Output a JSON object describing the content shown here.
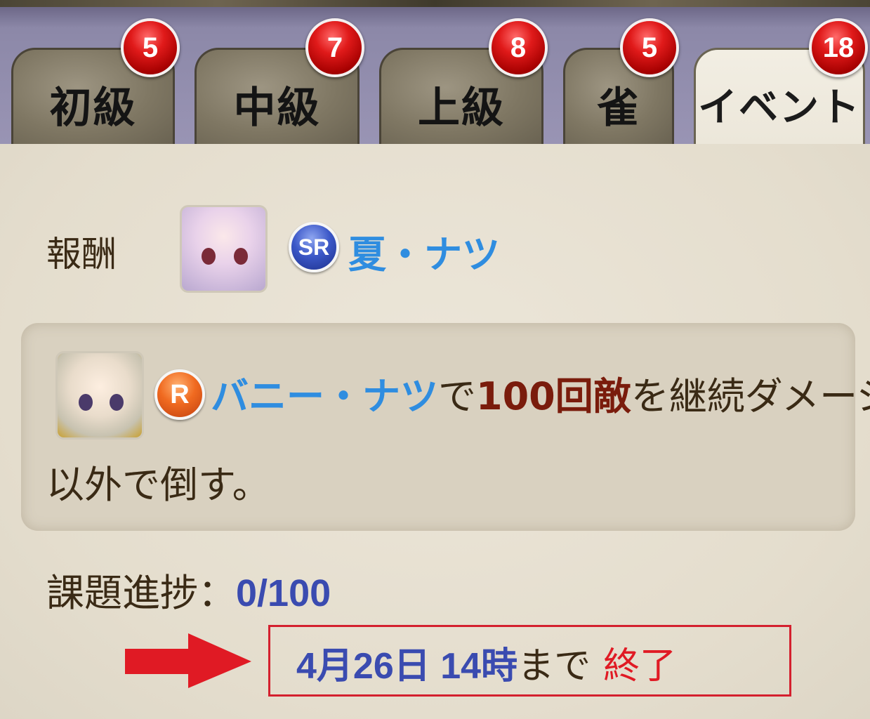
{
  "tabs": [
    {
      "label": "初級",
      "badge": "5",
      "active": false
    },
    {
      "label": "中級",
      "badge": "7",
      "active": false
    },
    {
      "label": "上級",
      "badge": "8",
      "active": false
    },
    {
      "label": "雀",
      "badge": "5",
      "active": false
    },
    {
      "label": "イベント",
      "badge": "18",
      "active": true
    }
  ],
  "reward": {
    "label": "報酬",
    "rarity": "SR",
    "name": "夏・ナツ"
  },
  "task": {
    "rarity": "R",
    "character": "バニー・ナツ",
    "text_de": "で",
    "highlight": "100回敵",
    "text_rest": "を継続ダメージ",
    "line2": "以外で倒す。"
  },
  "progress": {
    "label": "課題進捗：",
    "value": "0/100"
  },
  "deadline": {
    "date": "4月26日 14時",
    "suffix": "まで",
    "status": "終了"
  },
  "colors": {
    "accent_blue": "#3a4bb0",
    "name_blue": "#2f8de0",
    "highlight_red": "#7a1c0c",
    "status_red": "#e01a24",
    "arrow_red": "#e01a24"
  }
}
